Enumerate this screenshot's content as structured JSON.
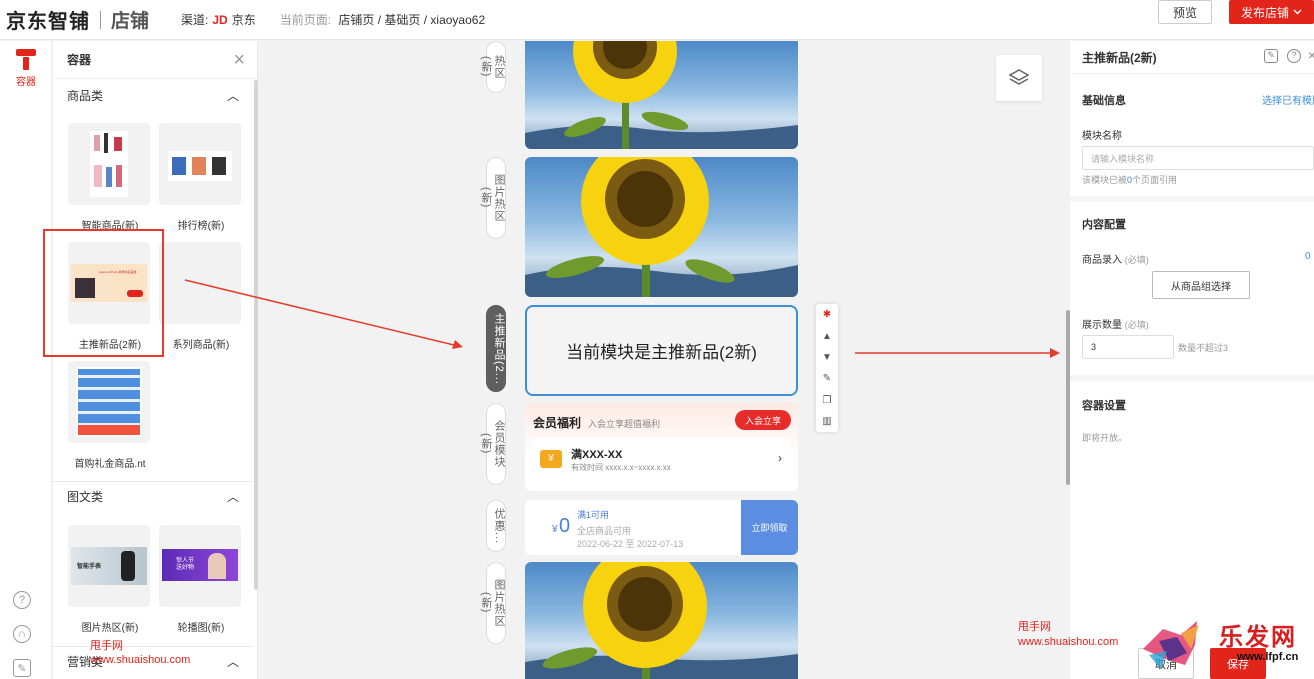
{
  "header": {
    "logo": "京东智铺",
    "logo_sub": "店铺",
    "channel_label": "渠道:",
    "channel_brand": "JD",
    "channel_name": "京东",
    "current_label": "当前页面:",
    "current_path": "店铺页 / 基础页 / xiaoyao62",
    "preview": "预览",
    "publish": "发布店铺"
  },
  "rail": {
    "container": "容器"
  },
  "left_panel": {
    "title": "容器",
    "sections": [
      {
        "title": "商品类",
        "items": [
          "智能商品(新)",
          "排行榜(新)",
          "主推新品(2新)",
          "系列商品(新)",
          "首购礼金商品.nt"
        ]
      },
      {
        "title": "图文类",
        "items": [
          "图片热区(新)",
          "轮播图(新)"
        ]
      },
      {
        "title": "营销类",
        "items": []
      }
    ],
    "thumb_text": {
      "hot_area": "智能手表",
      "carousel": "惊人节 送好物",
      "featured": "Apple AirPods 夏季新品首发"
    }
  },
  "canvas": {
    "labels": [
      "热区(新)",
      "图片热区(新)",
      "主推新品(2...",
      "会员模块(新)",
      "优惠...",
      "图片热区(新)"
    ],
    "current_module": "当前模块是主推新品(2新)",
    "member": {
      "title": "会员福利",
      "subtitle": "入会立享超值福利",
      "join": "入会立享",
      "coupon_icon": "¥",
      "coupon_title": "满XXX-XX",
      "coupon_valid": "有效时间 xxxx.x.x~xxxx.x.xx"
    },
    "discount": {
      "yen": "¥",
      "amount": "0",
      "condition": "满1可用",
      "scope": "全店商品可用",
      "dates": "2022-06-22 至 2022-07-13",
      "claim": "立即领取"
    }
  },
  "right_panel": {
    "title": "主推新品(2新)",
    "basic": "基础信息",
    "select_existing": "选择已有模版",
    "module_name_label": "模块名称",
    "module_name_placeholder": "请输入模块名称",
    "module_ref_pre": "该模块已被",
    "module_ref_count": "0",
    "module_ref_post": "个页面引用",
    "content_config": "内容配置",
    "product_entry": "商品录入",
    "required": "(必填)",
    "product_count_right": "0",
    "choose_group": "从商品组选择",
    "display_count": "展示数量",
    "display_value": "3",
    "display_hint": "数量不超过3",
    "container_settings": "容器设置",
    "coming_soon": "即将开放。",
    "cancel": "取消",
    "save": "保存"
  },
  "watermarks": {
    "site_name": "甩手网",
    "site_url": "www.shuaishou.com",
    "brand": "乐发网",
    "brand_url": "www.lfpf.cn"
  },
  "colors": {
    "accent": "#e1251b",
    "select_blue": "#3d8fd8",
    "annotation_red": "#e53b2c"
  }
}
